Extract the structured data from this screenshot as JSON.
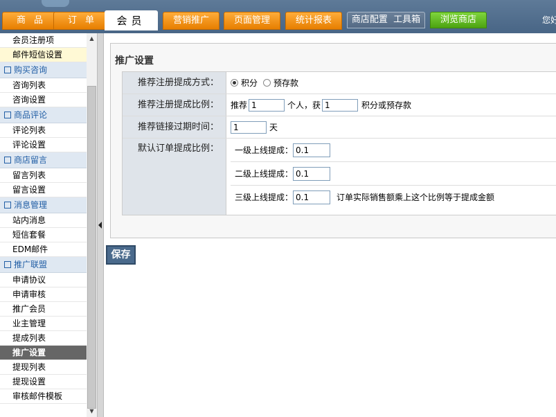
{
  "topnav": {
    "tabs": [
      {
        "label": "商品"
      },
      {
        "label": "订单"
      },
      {
        "label": "会员"
      },
      {
        "label": "营销推广"
      },
      {
        "label": "页面管理"
      },
      {
        "label": "统计报表"
      },
      {
        "label": "商店配置  工具箱"
      },
      {
        "label": "浏览商店"
      }
    ],
    "welcome": "您好"
  },
  "sidebar": {
    "items": [
      {
        "type": "item",
        "label": "会员注册项"
      },
      {
        "type": "item",
        "label": "邮件短信设置",
        "highlight": true
      },
      {
        "type": "header",
        "label": "购买咨询"
      },
      {
        "type": "item",
        "label": "咨询列表"
      },
      {
        "type": "item",
        "label": "咨询设置"
      },
      {
        "type": "header",
        "label": "商品评论"
      },
      {
        "type": "item",
        "label": "评论列表"
      },
      {
        "type": "item",
        "label": "评论设置"
      },
      {
        "type": "header",
        "label": "商店留言"
      },
      {
        "type": "item",
        "label": "留言列表"
      },
      {
        "type": "item",
        "label": "留言设置"
      },
      {
        "type": "header",
        "label": "消息管理"
      },
      {
        "type": "item",
        "label": "站内消息"
      },
      {
        "type": "item",
        "label": "短信套餐"
      },
      {
        "type": "item",
        "label": "EDM邮件"
      },
      {
        "type": "header",
        "label": "推广联盟"
      },
      {
        "type": "item",
        "label": "申请协议"
      },
      {
        "type": "item",
        "label": "申请审核"
      },
      {
        "type": "item",
        "label": "推广会员"
      },
      {
        "type": "item",
        "label": "业主管理"
      },
      {
        "type": "item",
        "label": "提成列表"
      },
      {
        "type": "item",
        "label": "推广设置",
        "active": true
      },
      {
        "type": "item",
        "label": "提现列表"
      },
      {
        "type": "item",
        "label": "提现设置"
      },
      {
        "type": "item",
        "label": "审核邮件模板"
      }
    ]
  },
  "page": {
    "title": "推广设置",
    "form": {
      "method_label": "推荐注册提成方式：",
      "method_options": [
        "积分",
        "预存款"
      ],
      "method_selected": "积分",
      "ratio_label": "推荐注册提成比例：",
      "ratio_prefix": "推荐",
      "ratio_people": "1",
      "ratio_mid": "个人，获",
      "ratio_reward": "1",
      "ratio_suffix": "积分或预存款",
      "expire_label": "推荐链接过期时间：",
      "expire_value": "1",
      "expire_unit": "天",
      "order_label": "默认订单提成比例：",
      "level1_label": "一级上线提成：",
      "level1_value": "0.1",
      "level2_label": "二级上线提成：",
      "level2_value": "0.1",
      "level3_label": "三级上线提成：",
      "level3_value": "0.1",
      "level3_note": "订单实际销售额乘上这个比例等于提成金额"
    },
    "save_label": "保存"
  }
}
